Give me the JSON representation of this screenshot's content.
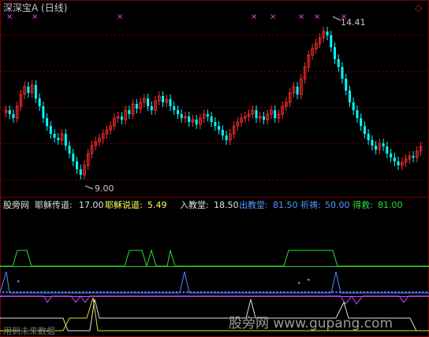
{
  "header": {
    "title": "深深宝A (日线)",
    "icon": "diamond-icon",
    "title_color": "#c8c8c8"
  },
  "price_panel": {
    "markers": [
      "×",
      "×",
      "×",
      "×",
      "×",
      "×",
      "×",
      "×"
    ],
    "marker_color": "#ff44ff",
    "high_label": "14.41",
    "low_label": "9.00",
    "up_color": "#ff3030",
    "down_color": "#00ffff",
    "grid_color": "#7a0000"
  },
  "indicator_panel": {
    "name": "股旁网",
    "params": [
      {
        "label": "耶稣传道:",
        "value": "17.00",
        "color": "#e0e0e0"
      },
      {
        "label": "耶稣说道:",
        "value": "5.49",
        "color": "#ffff55"
      },
      {
        "label": "入教堂:",
        "value": "18.50",
        "color": "#e0e0e0"
      },
      {
        "label": "出教堂:",
        "value": "81.50",
        "color": "#5599ff"
      },
      {
        "label": "祈祷:",
        "value": "50.00",
        "color": "#5599ff"
      },
      {
        "label": "得救:",
        "value": "81.00",
        "color": "#33dd33"
      }
    ]
  },
  "watermarks": {
    "left": "用到未来数据",
    "right": "股旁网 www.gupang.com"
  }
}
